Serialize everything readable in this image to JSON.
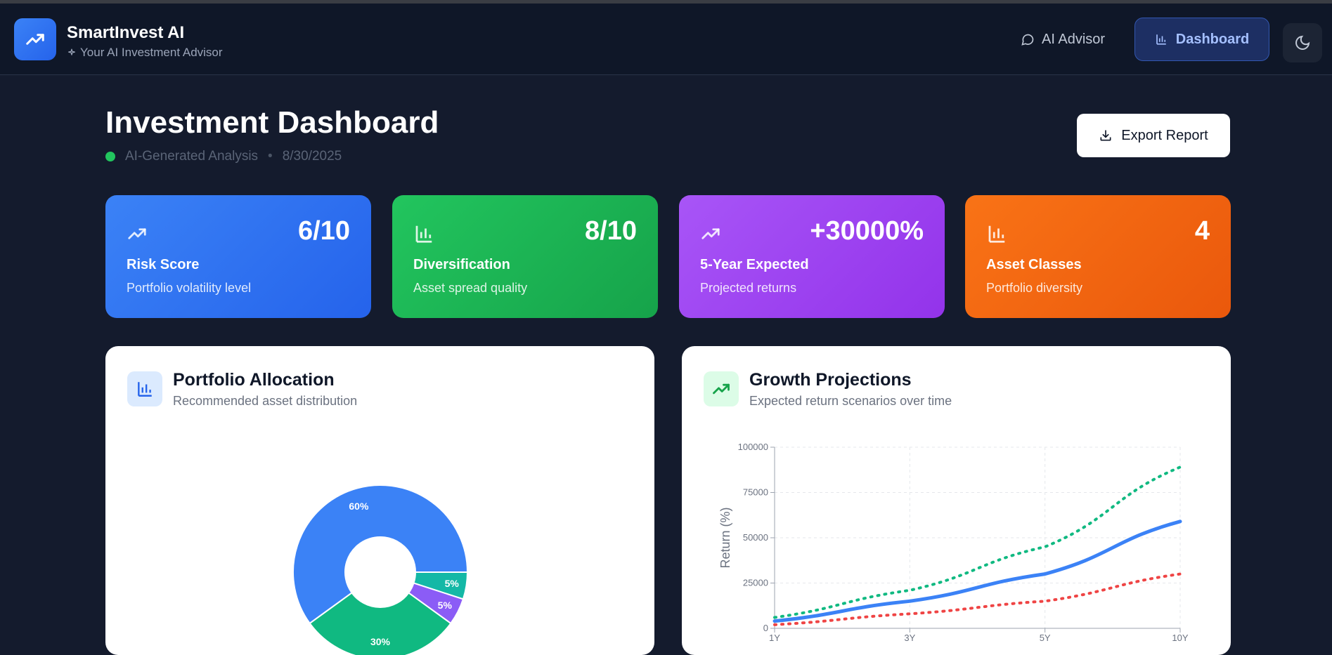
{
  "header": {
    "app_title": "SmartInvest AI",
    "app_subtitle": "Your AI Investment Advisor",
    "nav": {
      "advisor_label": "AI Advisor",
      "dashboard_label": "Dashboard"
    }
  },
  "page": {
    "title": "Investment Dashboard",
    "analysis_label": "AI-Generated Analysis",
    "separator": "•",
    "date": "8/30/2025",
    "export_label": "Export Report"
  },
  "stats": [
    {
      "value": "6/10",
      "label": "Risk Score",
      "desc": "Portfolio volatility level"
    },
    {
      "value": "8/10",
      "label": "Diversification",
      "desc": "Asset spread quality"
    },
    {
      "value": "+30000%",
      "label": "5-Year Expected",
      "desc": "Projected returns"
    },
    {
      "value": "4",
      "label": "Asset Classes",
      "desc": "Portfolio diversity"
    }
  ],
  "panels": {
    "allocation": {
      "title": "Portfolio Allocation",
      "subtitle": "Recommended asset distribution"
    },
    "growth": {
      "title": "Growth Projections",
      "subtitle": "Expected return scenarios over time"
    }
  },
  "colors": {
    "blue": "#3b82f6",
    "green": "#10b981",
    "purple": "#8b5cf6",
    "teal": "#14b8a6",
    "red": "#ef4444"
  },
  "chart_data": [
    {
      "type": "pie",
      "slices": [
        {
          "label": "60%",
          "value": 60,
          "color": "#3b82f6"
        },
        {
          "label": "30%",
          "value": 30,
          "color": "#10b981"
        },
        {
          "label": "5%",
          "value": 5,
          "color": "#8b5cf6"
        },
        {
          "label": "5%",
          "value": 5,
          "color": "#14b8a6"
        }
      ]
    },
    {
      "type": "line",
      "x": [
        "1Y",
        "3Y",
        "5Y",
        "10Y"
      ],
      "ylabel": "Return (%)",
      "ylim": [
        0,
        100000
      ],
      "yticks": [
        "0",
        "25000",
        "50000",
        "75000",
        "100000"
      ],
      "grid": true,
      "series": [
        {
          "values": [
            6000,
            21000,
            45000,
            89000
          ],
          "color": "#10b981",
          "style": "dotted"
        },
        {
          "values": [
            4000,
            15000,
            30000,
            59000
          ],
          "color": "#3b82f6",
          "style": "solid"
        },
        {
          "values": [
            2000,
            8000,
            15000,
            30000
          ],
          "color": "#ef4444",
          "style": "dotted"
        }
      ]
    }
  ]
}
